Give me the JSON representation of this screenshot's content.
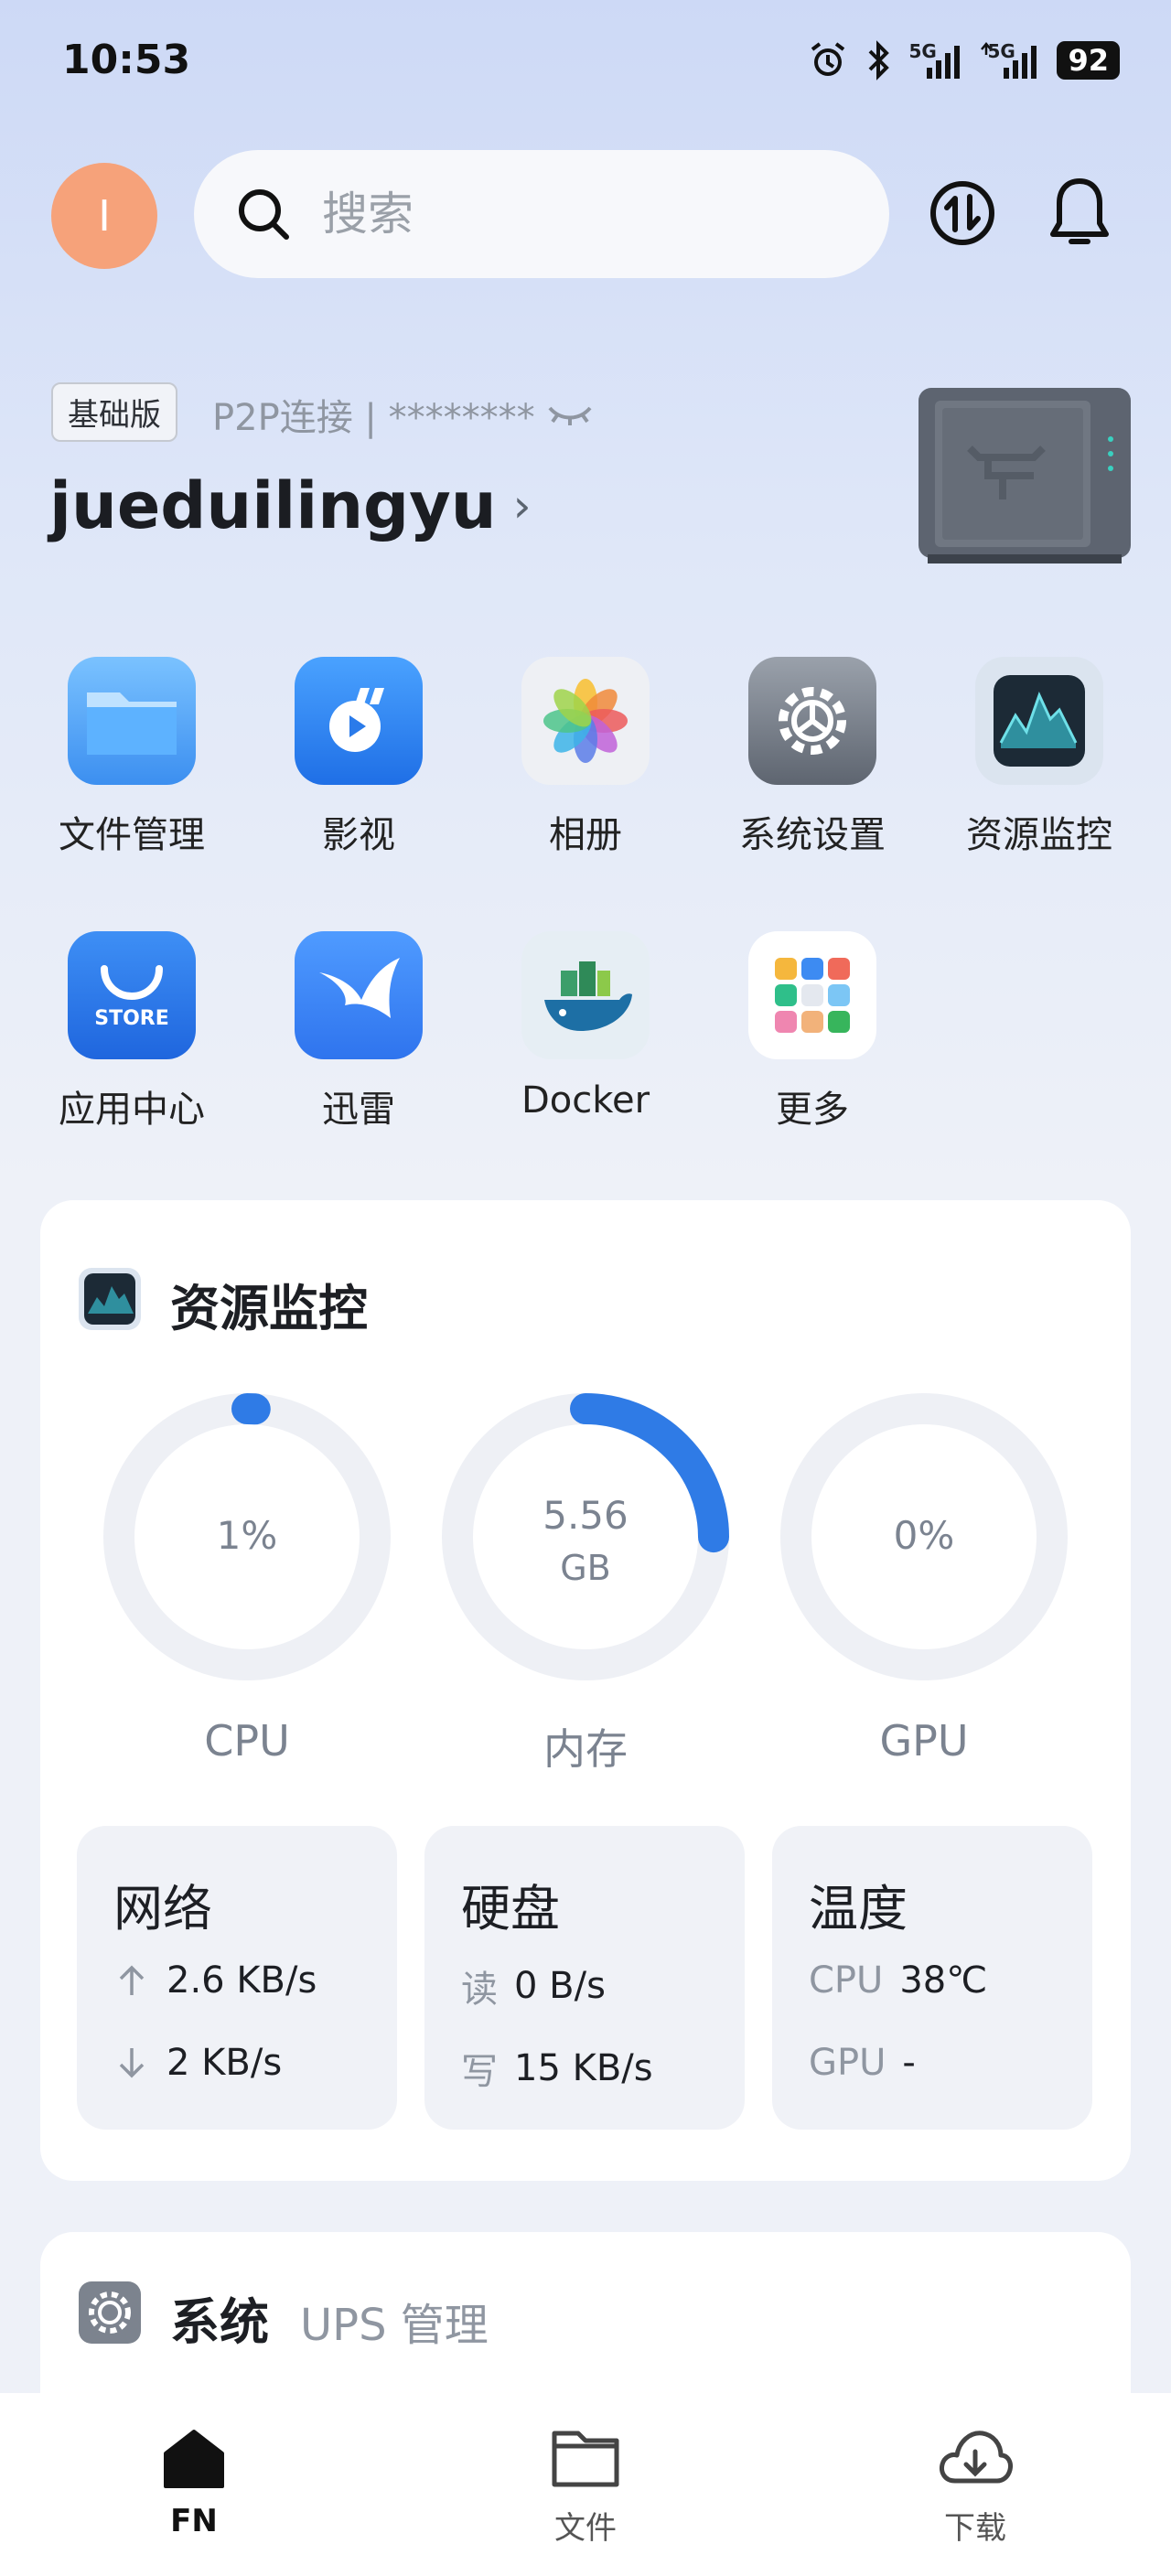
{
  "status_bar": {
    "time": "10:53",
    "network1": "5G",
    "network2": "5G",
    "battery": "92"
  },
  "header": {
    "avatar_letter": "I",
    "search_placeholder": "搜索"
  },
  "device": {
    "edition_badge": "基础版",
    "connection_text": "P2P连接 | ********",
    "name": "jueduilingyu"
  },
  "apps": [
    {
      "label": "文件管理",
      "icon": "folder-icon"
    },
    {
      "label": "影视",
      "icon": "video-icon"
    },
    {
      "label": "相册",
      "icon": "photos-icon"
    },
    {
      "label": "系统设置",
      "icon": "settings-icon"
    },
    {
      "label": "资源监控",
      "icon": "monitor-icon"
    },
    {
      "label": "应用中心",
      "icon": "store-icon"
    },
    {
      "label": "迅雷",
      "icon": "thunder-icon"
    },
    {
      "label": "Docker",
      "icon": "docker-icon"
    },
    {
      "label": "更多",
      "icon": "more-icon"
    }
  ],
  "store_icon_text": "STORE",
  "resource_monitor": {
    "title": "资源监控",
    "gauges": [
      {
        "label": "CPU",
        "value": "1%",
        "fraction": 0.01
      },
      {
        "label": "内存",
        "value": "5.56",
        "unit": "GB",
        "fraction": 0.25
      },
      {
        "label": "GPU",
        "value": "0%",
        "fraction": 0.0
      }
    ],
    "network": {
      "title": "网络",
      "up": "2.6 KB/s",
      "down": "2 KB/s"
    },
    "disk": {
      "title": "硬盘",
      "read_label": "读",
      "read": "0 B/s",
      "write_label": "写",
      "write": "15 KB/s"
    },
    "temperature": {
      "title": "温度",
      "cpu_label": "CPU",
      "cpu": "38℃",
      "gpu_label": "GPU",
      "gpu": "-"
    }
  },
  "system_card": {
    "title": "系统",
    "subtitle": "UPS 管理"
  },
  "bottom_nav": [
    {
      "label": "FN",
      "icon": "home-icon",
      "active": true
    },
    {
      "label": "文件",
      "icon": "folder-outline-icon",
      "active": false
    },
    {
      "label": "下载",
      "icon": "cloud-download-icon",
      "active": false
    }
  ],
  "colors": {
    "accent": "#2f7be6",
    "avatar": "#f6a27a",
    "ring_track": "#eef0f5"
  }
}
